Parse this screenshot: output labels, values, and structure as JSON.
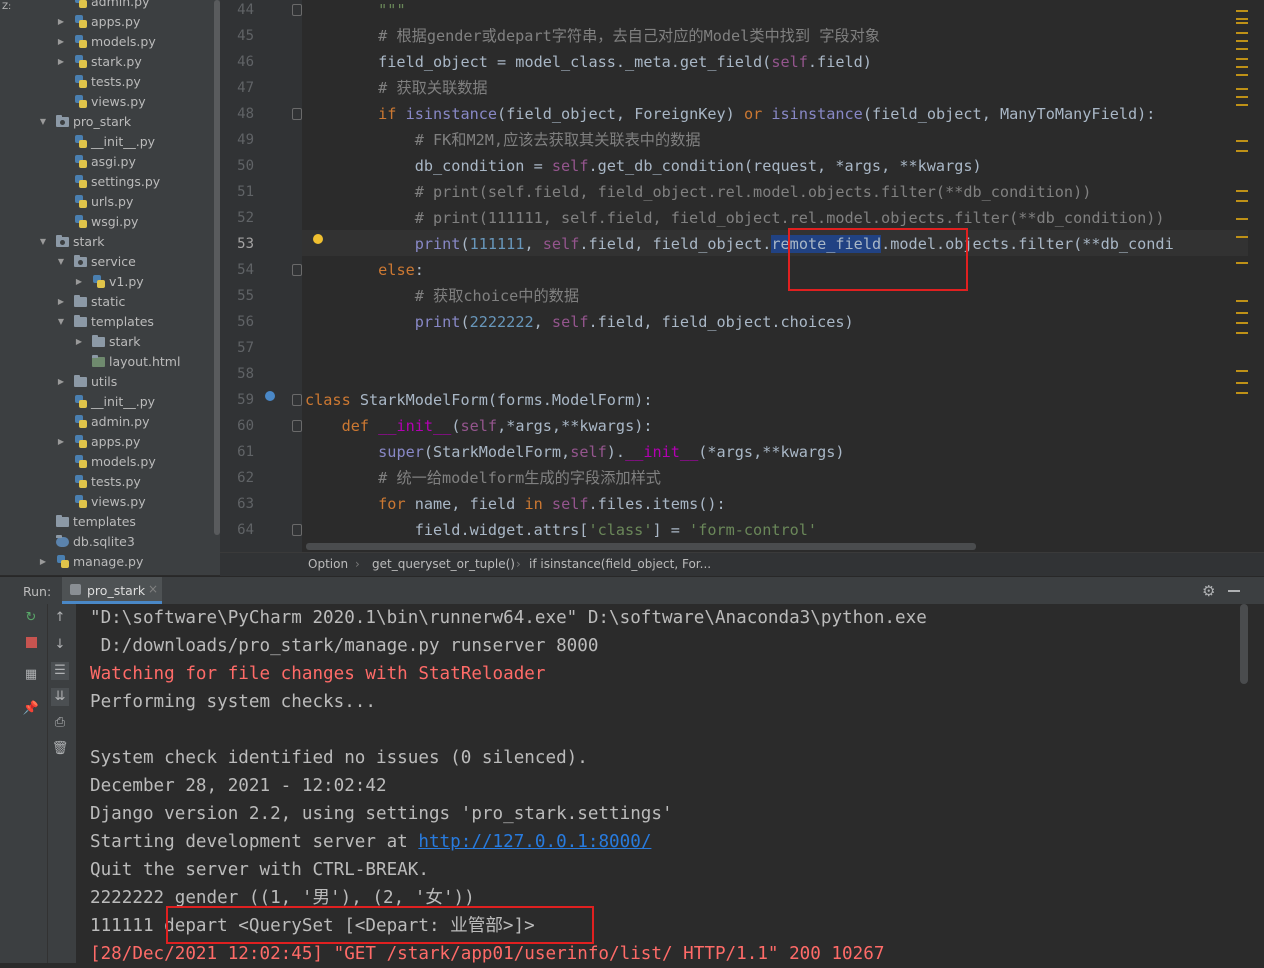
{
  "left_strip": {
    "tab_label": "Z:"
  },
  "project_tree": {
    "items": [
      {
        "label": "admin.py",
        "indent": 3,
        "type": "py",
        "arrow": ""
      },
      {
        "label": "apps.py",
        "indent": 3,
        "type": "py",
        "arrow": "right"
      },
      {
        "label": "models.py",
        "indent": 3,
        "type": "py",
        "arrow": "right"
      },
      {
        "label": "stark.py",
        "indent": 3,
        "type": "py",
        "arrow": "right"
      },
      {
        "label": "tests.py",
        "indent": 3,
        "type": "py",
        "arrow": ""
      },
      {
        "label": "views.py",
        "indent": 3,
        "type": "py",
        "arrow": ""
      },
      {
        "label": "pro_stark",
        "indent": 2,
        "type": "folder",
        "arrow": "down"
      },
      {
        "label": "__init__.py",
        "indent": 3,
        "type": "py",
        "arrow": ""
      },
      {
        "label": "asgi.py",
        "indent": 3,
        "type": "py",
        "arrow": ""
      },
      {
        "label": "settings.py",
        "indent": 3,
        "type": "py",
        "arrow": ""
      },
      {
        "label": "urls.py",
        "indent": 3,
        "type": "py",
        "arrow": ""
      },
      {
        "label": "wsgi.py",
        "indent": 3,
        "type": "py",
        "arrow": ""
      },
      {
        "label": "stark",
        "indent": 2,
        "type": "folder",
        "arrow": "down"
      },
      {
        "label": "service",
        "indent": 3,
        "type": "folder",
        "arrow": "down"
      },
      {
        "label": "v1.py",
        "indent": 4,
        "type": "py",
        "arrow": "right"
      },
      {
        "label": "static",
        "indent": 3,
        "type": "folder",
        "arrow": "right"
      },
      {
        "label": "templates",
        "indent": 3,
        "type": "folder",
        "arrow": "down"
      },
      {
        "label": "stark",
        "indent": 4,
        "type": "folder",
        "arrow": "right"
      },
      {
        "label": "layout.html",
        "indent": 4,
        "type": "html",
        "arrow": ""
      },
      {
        "label": "utils",
        "indent": 3,
        "type": "folder",
        "arrow": "right"
      },
      {
        "label": "__init__.py",
        "indent": 3,
        "type": "py",
        "arrow": ""
      },
      {
        "label": "admin.py",
        "indent": 3,
        "type": "py",
        "arrow": ""
      },
      {
        "label": "apps.py",
        "indent": 3,
        "type": "py",
        "arrow": "right"
      },
      {
        "label": "models.py",
        "indent": 3,
        "type": "py",
        "arrow": ""
      },
      {
        "label": "tests.py",
        "indent": 3,
        "type": "py",
        "arrow": ""
      },
      {
        "label": "views.py",
        "indent": 3,
        "type": "py",
        "arrow": ""
      },
      {
        "label": "templates",
        "indent": 2,
        "type": "folder",
        "arrow": ""
      },
      {
        "label": "db.sqlite3",
        "indent": 2,
        "type": "db",
        "arrow": ""
      },
      {
        "label": "manage.py",
        "indent": 2,
        "type": "py",
        "arrow": "right"
      }
    ]
  },
  "editor": {
    "current_line": "53",
    "lines": [
      {
        "n": "44",
        "html": "        <span class=\"str\">\"\"\"</span>"
      },
      {
        "n": "45",
        "html": "        <span class=\"cm\"># 根据gender或depart字符串，去自己对应的Model类中找到 字段对象</span>"
      },
      {
        "n": "46",
        "html": "        field_object = model_class._meta.get_field(<span class=\"self\">self</span>.field)"
      },
      {
        "n": "47",
        "html": "        <span class=\"cm\"># 获取关联数据</span>"
      },
      {
        "n": "48",
        "html": "        <span class=\"kw\">if</span> <span class=\"bi\">isinstance</span>(field_object, ForeignKey) <span class=\"kw\">or</span> <span class=\"bi\">isinstance</span>(field_object, ManyToManyField):"
      },
      {
        "n": "49",
        "html": "            <span class=\"cm\"># FK和M2M,应该去获取其关联表中的数据</span>"
      },
      {
        "n": "50",
        "html": "            db_condition = <span class=\"self\">self</span>.get_db_condition(request, *args, **kwargs)"
      },
      {
        "n": "51",
        "html": "            <span class=\"cm\"># print(self.field, field_object.rel.model.objects.filter(**db_condition))</span>"
      },
      {
        "n": "52",
        "html": "            <span class=\"cm\"># print(111111, self.field, field_object.rel.model.objects.filter(**db_condition))</span>"
      },
      {
        "n": "53",
        "html": "            <span class=\"bi\">print</span>(<span class=\"num\">111111</span>, <span class=\"self\">self</span>.field, field_object.<span class=\"sel\">remote_field</span>.model.objects.filter(**db_condi"
      },
      {
        "n": "54",
        "html": "        <span class=\"kw\">else</span>:"
      },
      {
        "n": "55",
        "html": "            <span class=\"cm\"># 获取choice中的数据</span>"
      },
      {
        "n": "56",
        "html": "            <span class=\"bi\">print</span>(<span class=\"num\">2222222</span>, <span class=\"self\">self</span>.field, field_object.choices)"
      },
      {
        "n": "57",
        "html": ""
      },
      {
        "n": "58",
        "html": ""
      },
      {
        "n": "59",
        "html": "<span class=\"kw\">class</span> StarkModelForm(forms.ModelForm):"
      },
      {
        "n": "60",
        "html": "    <span class=\"kw\">def</span> <span class=\"mg\">__init__</span>(<span class=\"self\">self</span>,*args,**kwargs):"
      },
      {
        "n": "61",
        "html": "        <span class=\"bi\">super</span>(StarkModelForm,<span class=\"self\">self</span>).<span class=\"mg\">__init__</span>(*args,**kwargs)"
      },
      {
        "n": "62",
        "html": "        <span class=\"cm\"># 统一给modelform生成的字段添加样式</span>"
      },
      {
        "n": "63",
        "html": "        <span class=\"kw\">for</span> name, field <span class=\"kw\">in</span> <span class=\"self\">self</span>.files.items():"
      },
      {
        "n": "64",
        "html": "            field.widget.attrs[<span class=\"str\">'class'</span>] = <span class=\"str\">'form-control'</span>"
      }
    ]
  },
  "breadcrumb": {
    "items": [
      "Option",
      "get_queryset_or_tuple()",
      "if isinstance(field_object, For..."
    ]
  },
  "run_panel": {
    "run_label": "Run:",
    "tab_label": "pro_stark",
    "close_glyph": "×",
    "lines": [
      {
        "text": "\"D:\\software\\PyCharm 2020.1\\bin\\runnerw64.exe\" D:\\software\\Anaconda3\\python.exe",
        "style": "normal"
      },
      {
        "text": " D:/downloads/pro_stark/manage.py runserver 8000",
        "style": "normal"
      },
      {
        "text": "Watching for file changes with StatReloader",
        "style": "red"
      },
      {
        "text": "Performing system checks...",
        "style": "normal"
      },
      {
        "text": "",
        "style": "normal"
      },
      {
        "text": "System check identified no issues (0 silenced).",
        "style": "normal"
      },
      {
        "text": "December 28, 2021 - 12:02:42",
        "style": "normal"
      },
      {
        "text": "Django version 2.2, using settings 'pro_stark.settings'",
        "style": "normal"
      },
      {
        "text": "Starting development server at ",
        "style": "normal",
        "link": "http://127.0.0.1:8000/"
      },
      {
        "text": "Quit the server with CTRL-BREAK.",
        "style": "normal"
      },
      {
        "text": "2222222 gender ((1, '男'), (2, '女'))",
        "style": "normal"
      },
      {
        "text": "111111 depart <QuerySet [<Depart: 业管部>]>",
        "style": "normal"
      },
      {
        "text": "[28/Dec/2021 12:02:45] \"GET /stark/app01/userinfo/list/ HTTP/1.1\" 200 10267",
        "style": "red"
      }
    ]
  },
  "colors": {
    "highlight_box": "#e02020",
    "selection": "#214283"
  }
}
